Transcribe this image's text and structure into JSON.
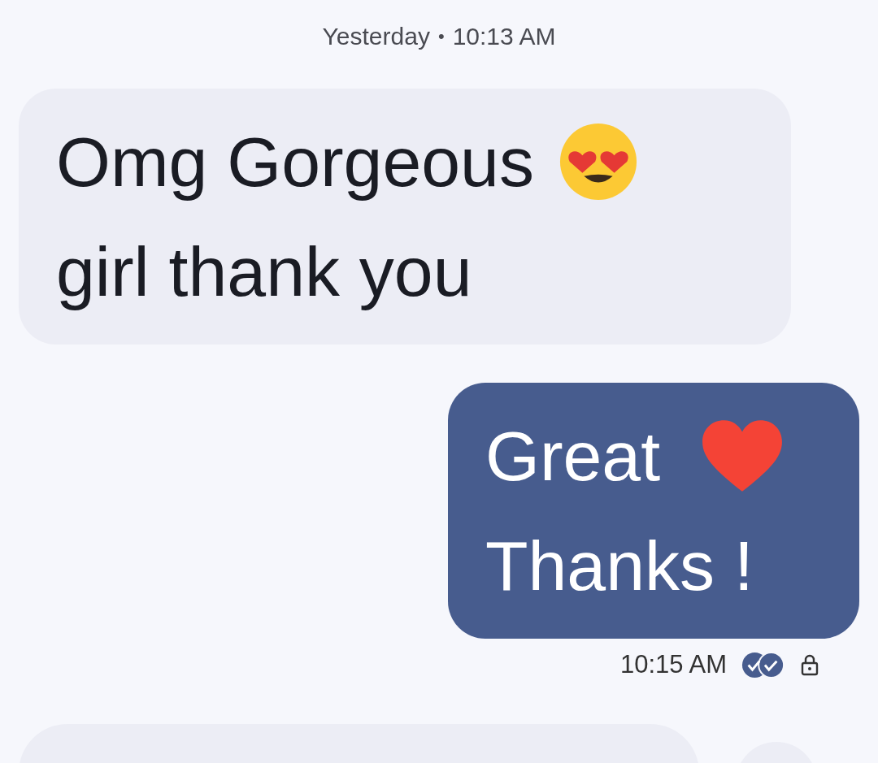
{
  "header": {
    "day": "Yesterday",
    "separator": "•",
    "time": "10:13 AM"
  },
  "messages": [
    {
      "kind": "incoming",
      "lines": [
        {
          "text": "Omg Gorgeous",
          "kind": "hearteyes"
        },
        {
          "text": "girl thank you",
          "kind": "plain"
        }
      ]
    },
    {
      "kind": "outgoing",
      "lines": [
        {
          "text": "Great",
          "kind": "heart"
        },
        {
          "text": "Thanks !",
          "kind": "plain"
        }
      ],
      "time": "10:15 AM",
      "read": true,
      "encrypted": true
    }
  ]
}
